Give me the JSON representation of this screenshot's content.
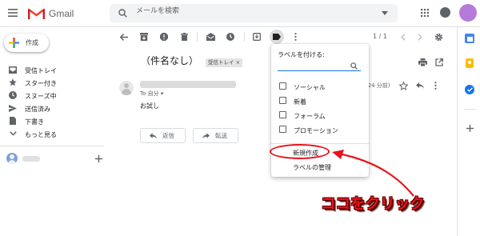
{
  "header": {
    "app_name": "Gmail",
    "search_placeholder": "メールを検索"
  },
  "sidebar": {
    "compose_label": "作成",
    "items": [
      {
        "label": "受信トレイ",
        "icon": "inbox-icon"
      },
      {
        "label": "スター付き",
        "icon": "star-icon"
      },
      {
        "label": "スヌーズ中",
        "icon": "clock-icon"
      },
      {
        "label": "送信済み",
        "icon": "send-icon"
      },
      {
        "label": "下書き",
        "icon": "draft-icon"
      },
      {
        "label": "もっと見る",
        "icon": "chevron-down-icon"
      }
    ]
  },
  "toolbar": {
    "pagination": "1 / 1"
  },
  "message": {
    "subject": "（件名なし）",
    "label_chip": "受信トレイ ×",
    "to_line": "To 自分 ▾",
    "time": "(24 分前)",
    "body": "お試し",
    "reply_label": "返信",
    "forward_label": "転送"
  },
  "label_menu": {
    "title": "ラベルを付ける:",
    "labels": [
      "ソーシャル",
      "新着",
      "フォーラム",
      "プロモーション"
    ],
    "create_new": "新規作成",
    "manage": "ラベルの管理"
  },
  "annotation": {
    "text": "ココをクリック",
    "color": "#e8141b"
  },
  "colors": {
    "accent_blue": "#1a73e8",
    "gmail_red": "#ea4335",
    "avatar_purple": "#b57ad9"
  }
}
